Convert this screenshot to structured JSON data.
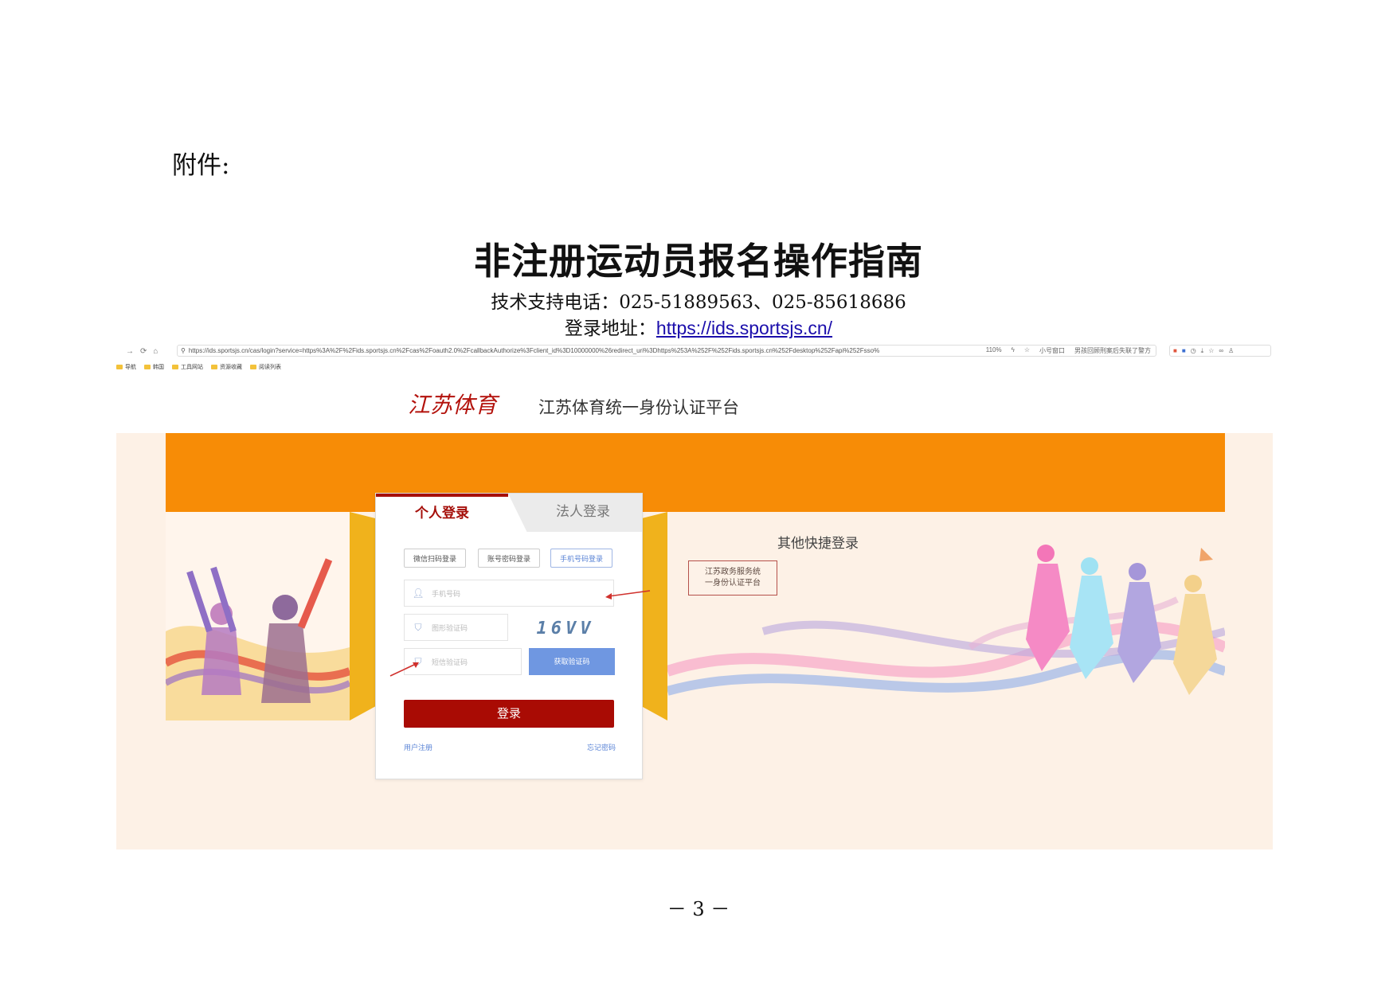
{
  "document": {
    "label": "附件:",
    "title": "非注册运动员报名操作指南",
    "support_line": "技术支持电话：025-51889563、025-85618686",
    "address_prefix": "登录地址：",
    "address_url": "https://ids.sportsjs.cn/",
    "page_number": "－ 3 －"
  },
  "browser": {
    "url": "https://ids.sportsjs.cn/cas/login?service=https%3A%2F%2Fids.sportsjs.cn%2Fcas%2Foauth2.0%2FcallbackAuthorize%3Fclient_id%3D10000000%26redirect_uri%3Dhttps%253A%252F%252Fids.sportsjs.cn%252Fdesktop%252Fapi%252Fsso%",
    "zoom": "110%",
    "small_window": "小号窗口",
    "promo": "男孩回顾刑案后失联了警方",
    "bookmarks": [
      "导航",
      "韩国",
      "工具网站",
      "资源收藏",
      "阅读列表"
    ]
  },
  "site": {
    "logo_text": "江苏体育",
    "name": "江苏体育统一身份认证平台"
  },
  "login": {
    "tab_personal": "个人登录",
    "tab_corporate": "法人登录",
    "mode_wechat": "微信扫码登录",
    "mode_account": "账号密码登录",
    "mode_phone": "手机号码登录",
    "phone_placeholder": "手机号码",
    "captcha_placeholder": "图形验证码",
    "captcha_text": "16VV",
    "sms_placeholder": "短信验证码",
    "sms_button": "获取验证码",
    "login_button": "登录",
    "register_link": "用户注册",
    "forgot_link": "忘记密码"
  },
  "quick_login": {
    "title": "其他快捷登录",
    "jsgov_line1": "江苏政务服务统",
    "jsgov_line2": "一身份认证平台"
  },
  "colors": {
    "brand_red": "#a90b04",
    "orange_band": "#f78c06",
    "sms_blue": "#6f97e1"
  }
}
